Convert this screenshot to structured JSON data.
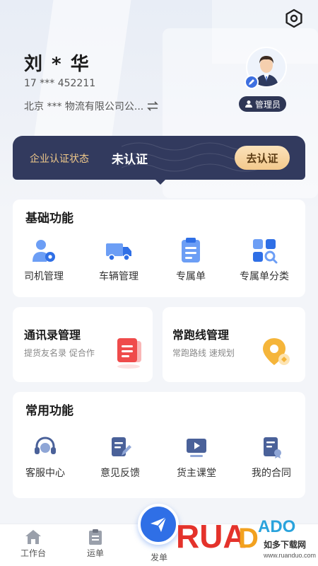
{
  "profile": {
    "name": "刘 * 华",
    "phone": "17 *** 452211",
    "company": "北京 *** 物流有限公司公...",
    "role": "管理员"
  },
  "certification": {
    "label": "企业认证状态",
    "status": "未认证",
    "action": "去认证"
  },
  "basic_functions": {
    "title": "基础功能",
    "items": [
      {
        "label": "司机管理",
        "icon": "driver-gear-icon"
      },
      {
        "label": "车辆管理",
        "icon": "truck-icon"
      },
      {
        "label": "专属单",
        "icon": "clipboard-icon"
      },
      {
        "label": "专属单分类",
        "icon": "category-search-icon"
      }
    ]
  },
  "contacts_card": {
    "title": "通讯录管理",
    "subtitle": "提货友名录 促合作",
    "icon": "document-icon"
  },
  "routes_card": {
    "title": "常跑线管理",
    "subtitle": "常跑路线 速规划",
    "icon": "location-pin-icon"
  },
  "common_functions": {
    "title": "常用功能",
    "items": [
      {
        "label": "客服中心",
        "icon": "headset-icon"
      },
      {
        "label": "意见反馈",
        "icon": "edit-document-icon"
      },
      {
        "label": "货主课堂",
        "icon": "video-play-icon"
      },
      {
        "label": "我的合同",
        "icon": "contract-icon"
      }
    ]
  },
  "tabbar": {
    "items": [
      {
        "label": "工作台",
        "icon": "home-icon"
      },
      {
        "label": "运单",
        "icon": "waybill-icon"
      },
      {
        "label": "发单",
        "icon": "send-icon"
      }
    ]
  },
  "watermark": {
    "brand": "RUANDADO",
    "tagline": "如多下载网",
    "url": "www.ruanduo.com"
  },
  "colors": {
    "accent": "#2f6fe6",
    "banner": "#323a5e",
    "gold": "#f0c98a"
  }
}
